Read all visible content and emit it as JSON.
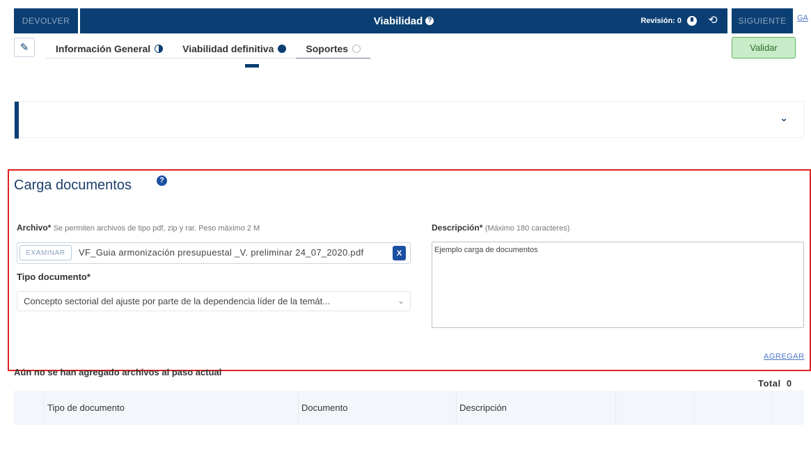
{
  "topbar": {
    "devolver_label": "DEVOLVER",
    "title": "Viabilidad",
    "revision_label": "Revisión: 0",
    "siguiente_label": "SIGUIENTE",
    "ga_link": "GA"
  },
  "tabs": [
    {
      "label": "Información General",
      "status": "partial"
    },
    {
      "label": "Viabilidad definitiva",
      "status": "complete"
    },
    {
      "label": "Soportes",
      "status": "empty"
    }
  ],
  "validar_label": "Validar",
  "carga": {
    "title": "Carga documentos",
    "archivo_label": "Archivo*",
    "archivo_hint": "Se permiten archivos de tipo pdf, zip y rar. Peso máximo 2 M",
    "examinar_label": "EXAMINAR",
    "file_name": "VF_Guia armonización presupuestal _V. preliminar 24_07_2020.pdf",
    "remove_label": "X",
    "tipo_label": "Tipo documento*",
    "tipo_value": "Concepto sectorial del ajuste por parte de la dependencia líder de la temát...",
    "descripcion_label": "Descripción*",
    "descripcion_hint": "(Máximo 180 caracteres)",
    "descripcion_value": "Ejemplo carga de documentos",
    "agregar_label": "AGREGAR"
  },
  "files": {
    "empty_message": "Aún no se han agregado archivos al paso actual",
    "total_label": "Total",
    "total_count": "0",
    "columns": [
      "",
      "Tipo de documento",
      "Documento",
      "Descripción",
      "",
      "",
      ""
    ]
  },
  "colors": {
    "primary": "#0b3f73",
    "accent_blue": "#1c4fa0",
    "highlight_border": "#e02020",
    "validar_bg": "#c8ecc8"
  },
  "icons": [
    "help-icon",
    "revision-icon",
    "history-icon",
    "pencil-icon",
    "chevron-down-icon",
    "close-icon"
  ]
}
